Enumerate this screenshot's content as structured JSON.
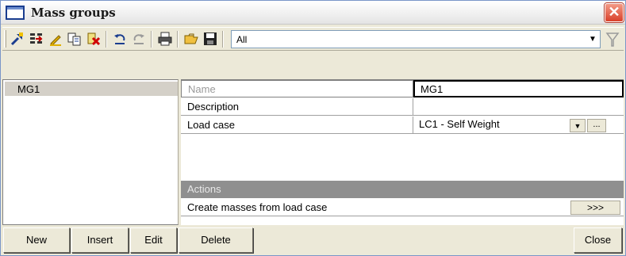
{
  "window": {
    "title": "Mass groups",
    "close_icon": "close-icon"
  },
  "toolbar": {
    "icons": [
      "new-item-icon",
      "insert-icon",
      "edit-icon",
      "copy-icon",
      "delete-icon",
      "undo-icon",
      "redo-icon",
      "print-icon",
      "open-icon",
      "save-icon"
    ],
    "filter_value": "All",
    "filter_icon": "funnel-icon"
  },
  "list": {
    "items": [
      "MG1"
    ]
  },
  "properties": {
    "name_label": "Name",
    "name_value": "MG1",
    "description_label": "Description",
    "description_value": "",
    "load_case_label": "Load case",
    "load_case_value": "LC1 - Self Weight",
    "load_case_dropdown": "▼",
    "load_case_more": "..."
  },
  "actions": {
    "header": "Actions",
    "items": [
      {
        "label": "Create masses from load case",
        "button": ">>>"
      }
    ]
  },
  "buttons": {
    "new": "New",
    "insert": "Insert",
    "edit": "Edit",
    "delete": "Delete",
    "close": "Close"
  },
  "colors": {
    "accent": "#1a3d8f",
    "close_red": "#d9402a",
    "actions_header_bg": "#8f8f8f"
  }
}
